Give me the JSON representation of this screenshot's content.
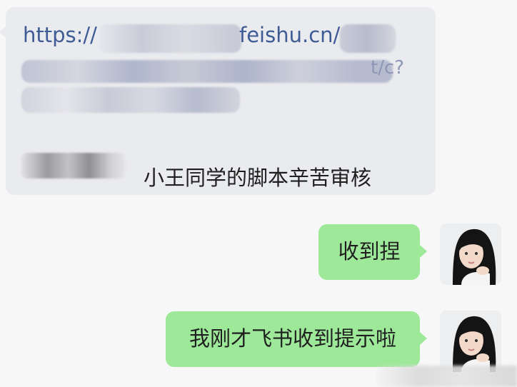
{
  "incoming_message": {
    "url_prefix": "https://",
    "url_domain": "feishu.cn/",
    "url_tail": "t/c?",
    "text": "小王同学的脚本辛苦审核"
  },
  "outgoing_messages": [
    {
      "text": "收到捏"
    },
    {
      "text": "我刚才飞书收到提示啦"
    }
  ],
  "colors": {
    "incoming_bubble": "#eaebee",
    "outgoing_bubble": "#9ee89a",
    "link": "#3f5b95",
    "background": "#f7f7f7"
  },
  "icons": [
    "user-avatar-photo"
  ]
}
